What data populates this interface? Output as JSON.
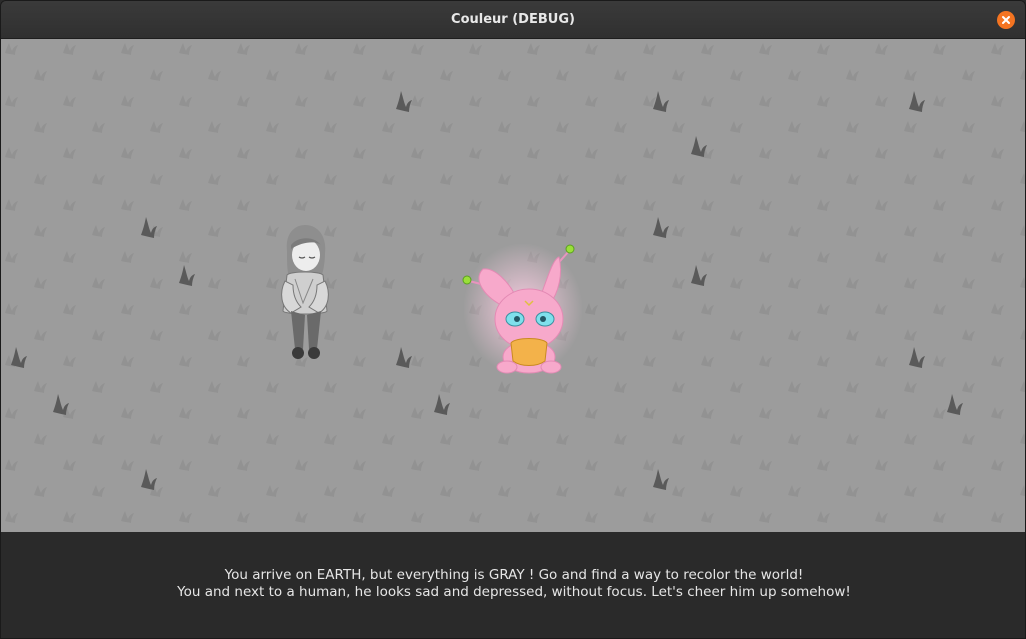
{
  "window": {
    "title": "Couleur (DEBUG)",
    "close_icon": "close-icon",
    "close_color": "#f47421"
  },
  "scene": {
    "background_color": "#9c9c9c",
    "ground_pattern_icon": "grass-tuft-icon",
    "characters": [
      {
        "name": "human",
        "description_icon": "human-character-icon",
        "state": "gray"
      },
      {
        "name": "alien",
        "description_icon": "pink-alien-character-icon",
        "color": "#f4a8c8"
      }
    ]
  },
  "dialog": {
    "line1": "You arrive on EARTH, but everything is GRAY ! Go and find a way to recolor the world!",
    "line2": "You and next to a human, he looks sad and depressed, without focus. Let's cheer him up somehow!"
  }
}
